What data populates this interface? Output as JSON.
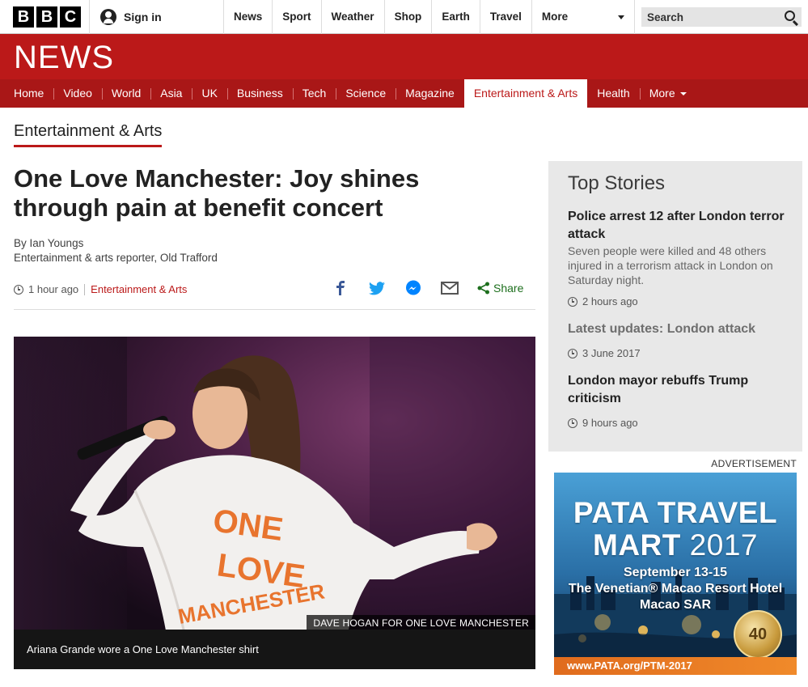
{
  "topbar": {
    "logo_letters": [
      "B",
      "B",
      "C"
    ],
    "signin_label": "Sign in",
    "nav": [
      "News",
      "Sport",
      "Weather",
      "Shop",
      "Earth",
      "Travel"
    ],
    "more_label": "More",
    "search_placeholder": "Search"
  },
  "masthead": {
    "title": "NEWS",
    "brand_color": "#bb1919",
    "nav": [
      {
        "label": "Home",
        "active": false
      },
      {
        "label": "Video",
        "active": false
      },
      {
        "label": "World",
        "active": false
      },
      {
        "label": "Asia",
        "active": false
      },
      {
        "label": "UK",
        "active": false
      },
      {
        "label": "Business",
        "active": false
      },
      {
        "label": "Tech",
        "active": false
      },
      {
        "label": "Science",
        "active": false
      },
      {
        "label": "Magazine",
        "active": false
      },
      {
        "label": "Entertainment & Arts",
        "active": true
      },
      {
        "label": "Health",
        "active": false
      }
    ],
    "more_label": "More"
  },
  "section": {
    "title": "Entertainment & Arts"
  },
  "article": {
    "headline": "One Love Manchester: Joy shines through pain at benefit concert",
    "byline_name": "By Ian Youngs",
    "byline_role": "Entertainment & arts reporter, Old Trafford",
    "time": "1 hour ago",
    "category": "Entertainment & Arts",
    "share_icons": [
      "facebook-icon",
      "twitter-icon",
      "messenger-icon",
      "email-icon"
    ],
    "share_label": "Share",
    "image_credit": "DAVE HOGAN FOR ONE LOVE MANCHESTER",
    "image_caption": "Ariana Grande wore a One Love Manchester shirt",
    "shirt_text": [
      "ONE",
      "LOVE",
      "MANCHESTER"
    ]
  },
  "top_stories": {
    "title": "Top Stories",
    "stories": [
      {
        "title": "Police arrest 12 after London terror attack",
        "summary": "Seven people were killed and 48 others injured in a terrorism attack in London on Saturday night.",
        "time": "2 hours ago"
      },
      {
        "title": "Latest updates: London attack",
        "summary": "",
        "time": "3 June 2017"
      },
      {
        "title": "London mayor rebuffs Trump criticism",
        "summary": "",
        "time": "9 hours ago"
      }
    ]
  },
  "ad": {
    "label": "ADVERTISEMENT",
    "title_line1": "PATA TRAVEL",
    "title_line2_bold": "MART",
    "title_line2_light": "2017",
    "date": "September 13-15",
    "venue": "The Venetian® Macao Resort Hotel",
    "city": "Macao SAR",
    "url": "www.PATA.org/PTM-2017",
    "badge_number": "40"
  }
}
